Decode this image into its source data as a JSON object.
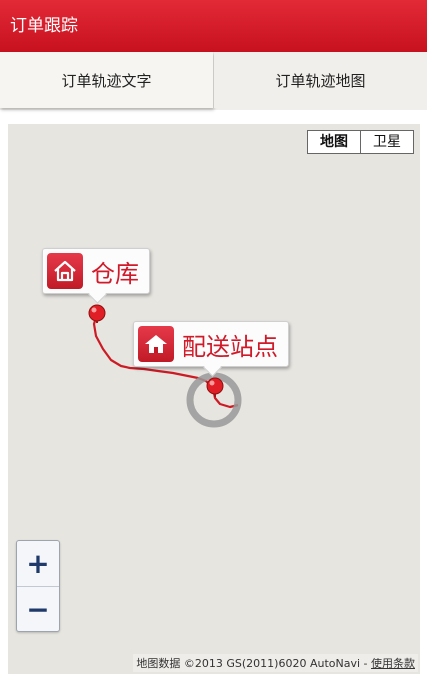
{
  "header": {
    "title": "订单跟踪"
  },
  "tabs": [
    {
      "label": "订单轨迹文字",
      "active": true
    },
    {
      "label": "订单轨迹地图",
      "active": false
    }
  ],
  "map": {
    "type_toggle": {
      "map_label": "地图",
      "satellite_label": "卫星",
      "selected": "map"
    },
    "markers": [
      {
        "label": "仓库",
        "icon": "home-outline-icon"
      },
      {
        "label": "配送站点",
        "icon": "house-icon"
      }
    ],
    "route_color": "#cc1b25",
    "zoom": {
      "in_label": "+",
      "out_label": "−"
    },
    "attribution": {
      "text": "地图数据 ©2013 GS(2011)6020 AutoNavi - ",
      "terms_label": "使用条款"
    }
  },
  "colors": {
    "brand": "#d41a28",
    "map_bg": "#e7e5e0"
  }
}
